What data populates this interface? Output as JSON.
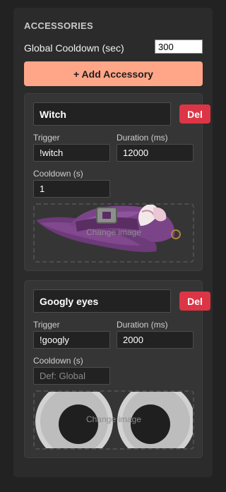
{
  "section": {
    "title": "ACCESSORIES"
  },
  "global_cooldown": {
    "label": "Global Cooldown (sec)",
    "value": "300"
  },
  "add_button": {
    "label": "+ Add Accessory"
  },
  "accessories": [
    {
      "name": "Witch",
      "delete_label": "Del",
      "trigger_label": "Trigger",
      "trigger": "!witch",
      "duration_label": "Duration (ms)",
      "duration": "12000",
      "cooldown_label": "Cooldown (s)",
      "cooldown": "1",
      "cooldown_placeholder": "",
      "image": {
        "depicts": "witch-hat",
        "overlay_text": "Change image"
      }
    },
    {
      "name": "Googly eyes",
      "delete_label": "Del",
      "trigger_label": "Trigger",
      "trigger": "!googly",
      "duration_label": "Duration (ms)",
      "duration": "2000",
      "cooldown_label": "Cooldown (s)",
      "cooldown": "",
      "cooldown_placeholder": "Def: Global",
      "image": {
        "depicts": "googly-eyes",
        "overlay_text": "Change image"
      }
    }
  ],
  "colors": {
    "page_bg": "#222222",
    "panel_bg": "#2b2b2b",
    "card_bg": "#353535",
    "accent_button": "#ffa688",
    "delete_button": "#dc3545"
  }
}
